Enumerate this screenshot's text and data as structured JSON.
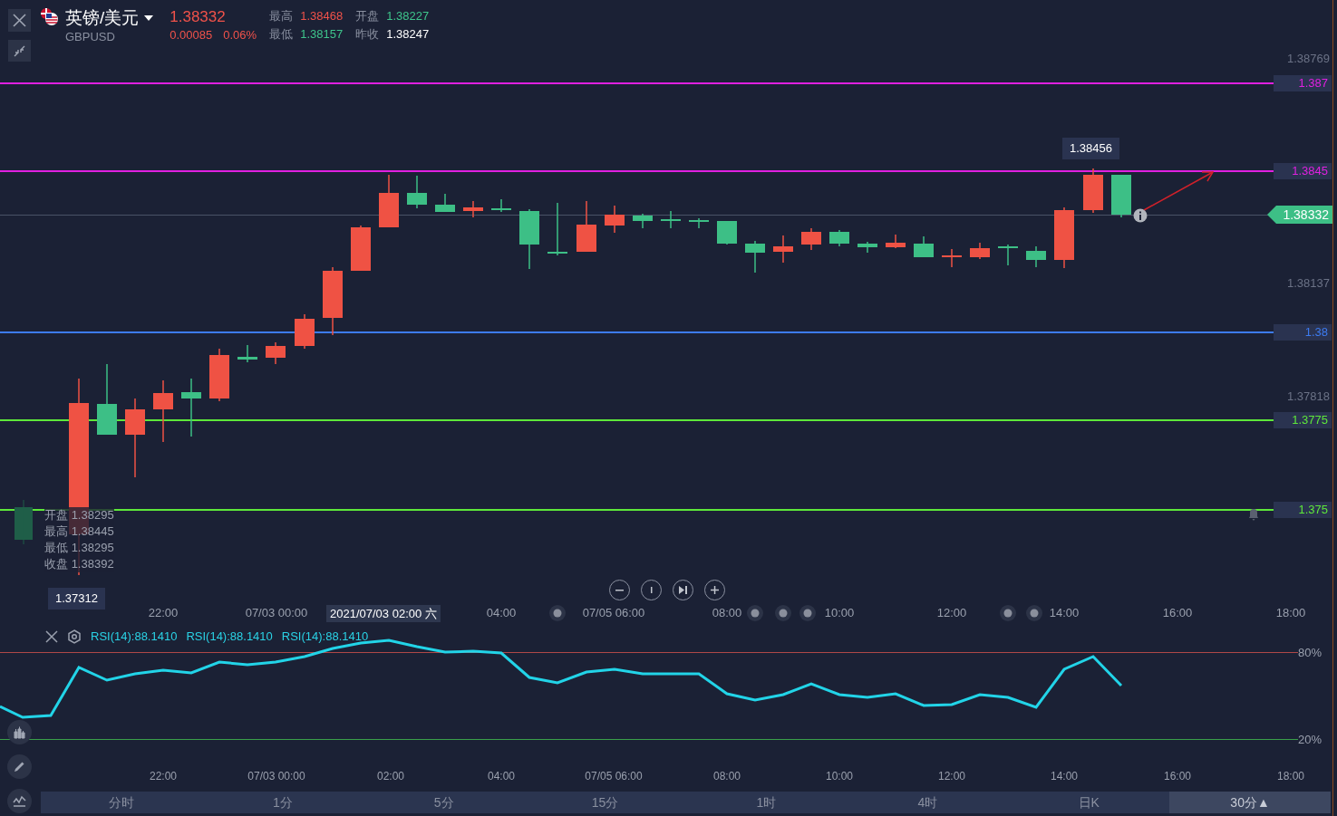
{
  "header": {
    "title": "英镑/美元",
    "symbol": "GBPUSD",
    "price": "1.38332",
    "change": "0.00085",
    "change_pct": "0.06%",
    "stats": [
      {
        "label": "最高",
        "value": "1.38468",
        "color": "#f0524a"
      },
      {
        "label": "开盘",
        "value": "1.38227",
        "color": "#3ec58c"
      },
      {
        "label": "最低",
        "value": "1.38157",
        "color": "#3ec58c"
      },
      {
        "label": "昨收",
        "value": "1.38247",
        "color": "#ffffff"
      }
    ]
  },
  "price_lines": [
    {
      "label": "1.387",
      "color": "#e020e0"
    },
    {
      "label": "1.3845",
      "color": "#e020e0"
    },
    {
      "label": "1.38",
      "color": "#3d7bf0"
    },
    {
      "label": "1.3775",
      "color": "#5ee83a"
    },
    {
      "label": "1.375",
      "color": "#5ee83a"
    }
  ],
  "axis_labels": [
    "1.38769",
    "1.38137",
    "1.37818"
  ],
  "current_price": "1.38332",
  "high_marker": "1.38456",
  "low_marker": "1.37312",
  "ohlc_overlay": [
    {
      "label": "开盘",
      "value": "1.38295"
    },
    {
      "label": "最高",
      "value": "1.38445"
    },
    {
      "label": "最低",
      "value": "1.38295"
    },
    {
      "label": "收盘",
      "value": "1.38392"
    }
  ],
  "time_axis": [
    "22:00",
    "07/03 00:00",
    "2021/07/03 02:00 六",
    "04:00",
    "07/05 06:00",
    "08:00",
    "10:00",
    "12:00",
    "14:00",
    "16:00",
    "18:00"
  ],
  "rsi": {
    "legends": [
      "RSI(14):88.1410",
      "RSI(14):88.1410",
      "RSI(14):88.1410"
    ],
    "levels": [
      "80%",
      "20%"
    ]
  },
  "rsi_time_axis": [
    "22:00",
    "07/03 00:00",
    "02:00",
    "04:00",
    "07/05 06:00",
    "08:00",
    "10:00",
    "12:00",
    "14:00",
    "16:00",
    "18:00"
  ],
  "periods": [
    {
      "label": "分时",
      "selected": false
    },
    {
      "label": "1分",
      "selected": false
    },
    {
      "label": "5分",
      "selected": false
    },
    {
      "label": "15分",
      "selected": false
    },
    {
      "label": "1时",
      "selected": false
    },
    {
      "label": "4时",
      "selected": false
    },
    {
      "label": "日K",
      "selected": false
    },
    {
      "label": "30分▲",
      "selected": true
    }
  ]
}
